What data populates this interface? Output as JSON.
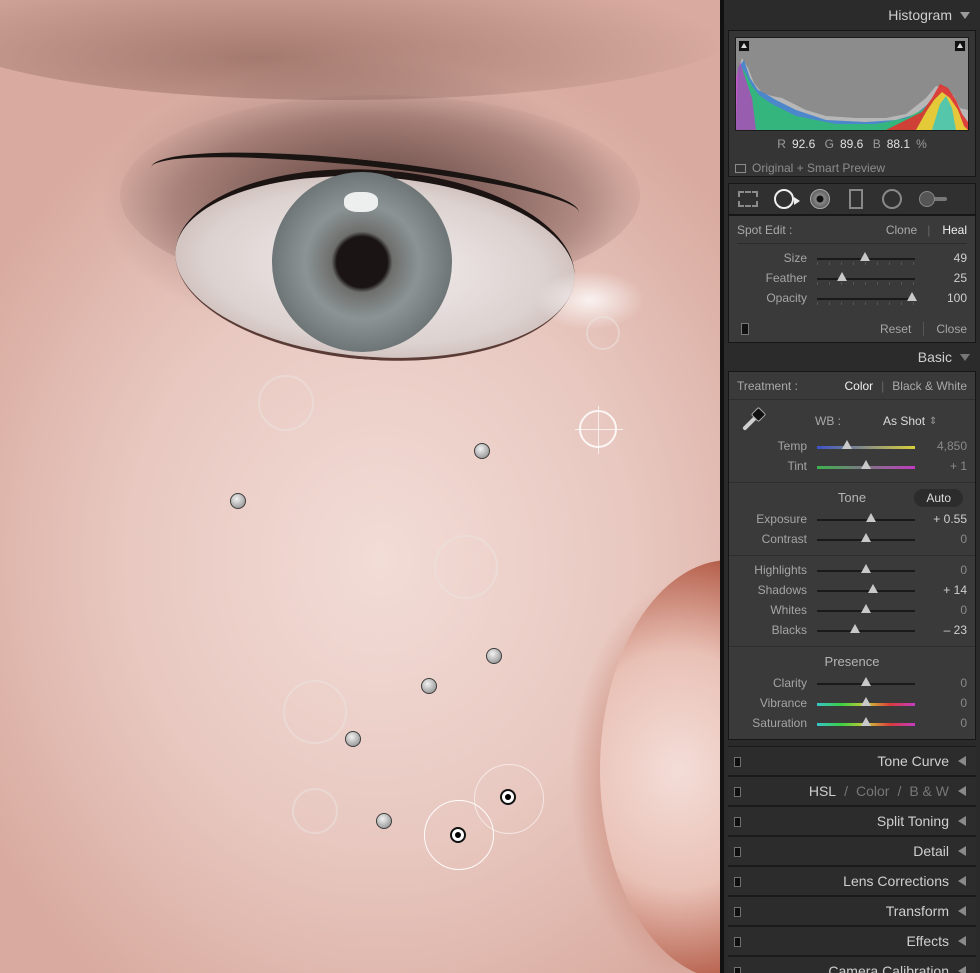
{
  "histogram": {
    "title": "Histogram",
    "r_label": "R",
    "r_value": "92.6",
    "g_label": "G",
    "g_value": "89.6",
    "b_label": "B",
    "b_value": "88.1",
    "percent": "%",
    "preview_label": "Original + Smart Preview"
  },
  "tools": [
    "crop-overlay",
    "spot-removal",
    "red-eye",
    "graduated-filter",
    "radial-filter",
    "adjustment-brush"
  ],
  "spot_edit": {
    "label": "Spot Edit :",
    "clone": "Clone",
    "heal": "Heal",
    "sliders": [
      {
        "label": "Size",
        "value": "49",
        "level": 0.49
      },
      {
        "label": "Feather",
        "value": "25",
        "level": 0.25
      },
      {
        "label": "Opacity",
        "value": "100",
        "level": 0.97
      }
    ],
    "reset": "Reset",
    "close": "Close"
  },
  "basic": {
    "title": "Basic",
    "treatment_label": "Treatment :",
    "color": "Color",
    "bw": "Black & White",
    "wb_label": "WB :",
    "wb_value": "As Shot",
    "wb_arrows": "⇕",
    "temp": {
      "label": "Temp",
      "value": "4,850",
      "level": 0.31
    },
    "tint": {
      "label": "Tint",
      "value": "+ 1",
      "level": 0.5
    },
    "tone_title": "Tone",
    "auto": "Auto",
    "exposure": {
      "label": "Exposure",
      "value": "+ 0.55",
      "level": 0.55
    },
    "contrast": {
      "label": "Contrast",
      "value": "0",
      "level": 0.5
    },
    "highlights": {
      "label": "Highlights",
      "value": "0",
      "level": 0.5
    },
    "shadows": {
      "label": "Shadows",
      "value": "+ 14",
      "level": 0.57
    },
    "whites": {
      "label": "Whites",
      "value": "0",
      "level": 0.5
    },
    "blacks": {
      "label": "Blacks",
      "value": "– 23",
      "level": 0.39
    },
    "presence_title": "Presence",
    "clarity": {
      "label": "Clarity",
      "value": "0",
      "level": 0.5
    },
    "vibrance": {
      "label": "Vibrance",
      "value": "0",
      "level": 0.5
    },
    "saturation": {
      "label": "Saturation",
      "value": "0",
      "level": 0.5
    }
  },
  "collapsed_panels": {
    "tone_curve": "Tone Curve",
    "hsl": "HSL",
    "hsl_sep": "/",
    "hsl_color": "Color",
    "hsl_bw": "B & W",
    "split_toning": "Split Toning",
    "detail": "Detail",
    "lens_corrections": "Lens Corrections",
    "transform": "Transform",
    "effects": "Effects",
    "camera_calibration": "Camera Calibration"
  },
  "colors": {
    "panel_bg": "#2a2a2a",
    "panel_section": "#3a3a3a",
    "text_active": "#f0f0f0"
  }
}
